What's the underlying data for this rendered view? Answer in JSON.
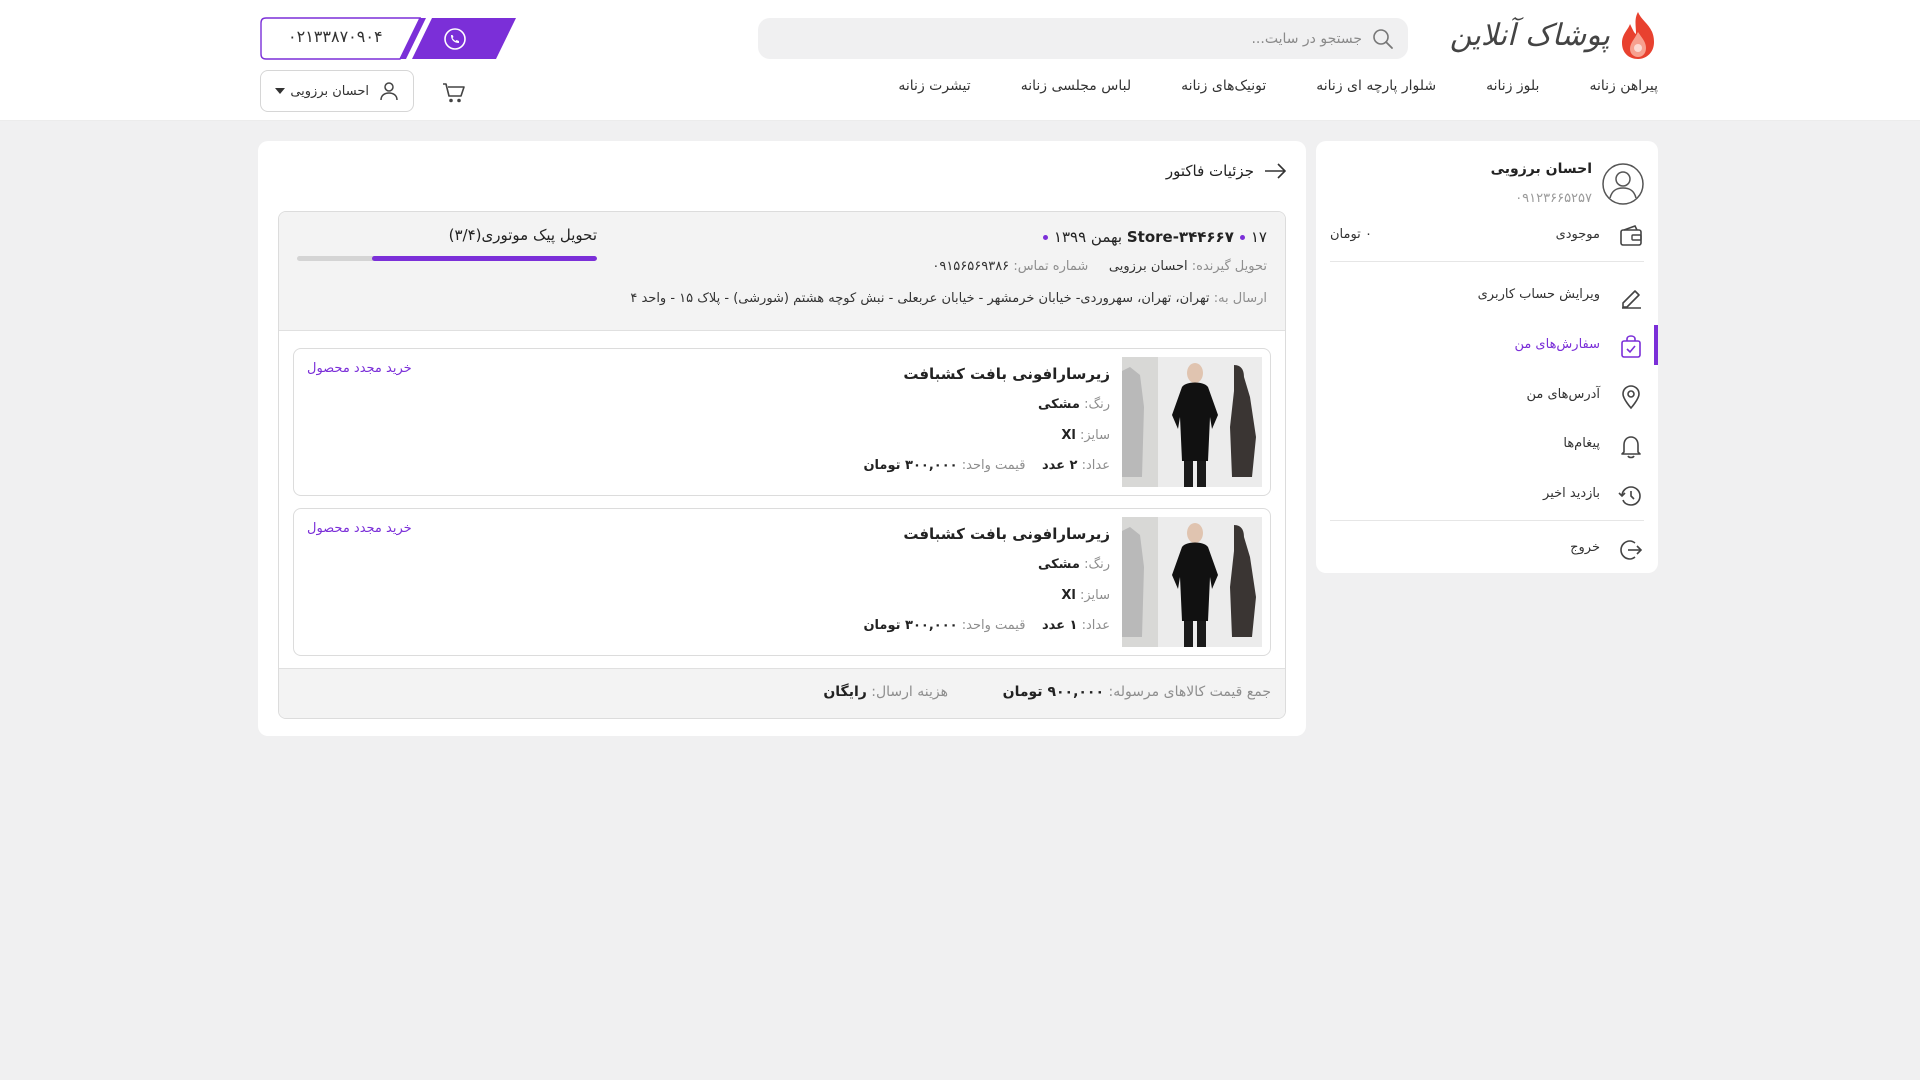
{
  "header": {
    "logo_text": "پوشاک آنلاین",
    "search_placeholder": "جستجو در سایت...",
    "phone_number": "۰۲۱۳۳۸۷۰۹۰۴",
    "user_name": "احسان برزویی",
    "nav": [
      "پیراهن زنانه",
      "بلوز زنانه",
      "شلوار پارچه ای زنانه",
      "تونیک‌های زنانه",
      "لباس مجلسی زنانه",
      "تیشرت زنانه"
    ],
    "accent_color": "#7b2fd8"
  },
  "sidebar": {
    "profile_name": "احسان برزویی",
    "profile_phone": "۰۹۱۲۳۶۶۵۲۵۷",
    "wallet_label": "موجودی",
    "wallet_value": "۰ تومان",
    "items": [
      {
        "label": "ویرایش حساب کاربری",
        "icon": "edit-icon"
      },
      {
        "label": "سفارش‌های من",
        "icon": "orders-bag-icon",
        "active": true
      },
      {
        "label": "آدرس‌های من",
        "icon": "location-pin-icon"
      },
      {
        "label": "پیغام‌ها",
        "icon": "bell-icon"
      },
      {
        "label": "بازدید اخیر",
        "icon": "history-icon"
      }
    ],
    "logout_label": "خروج"
  },
  "panel": {
    "title": "جزئیات فاکتور",
    "order": {
      "id": "Store-۳۴۴۶۶۷",
      "date": "۱۷ بهمن ۱۳۹۹",
      "recipient_label": "تحویل گیرنده:",
      "recipient": "احسان برزویی",
      "contact_label": "شماره تماس:",
      "contact": "۰۹۱۵۶۵۶۹۳۸۶",
      "address_label": "ارسال به:",
      "address": "تهران، تهران، سهروردی- خیابان خرمشهر - خیابان عربعلی - نبش کوچه هشتم (شورشی) - پلاک ۱۵ - واحد ۴",
      "delivery_label": "تحویل پیک موتوری(۳/۴)",
      "delivery_progress": 0.75
    },
    "items": [
      {
        "name": "زیرسارافونی بافت کشبافت",
        "color_label": "رنگ:",
        "color": "مشکی",
        "size_label": "سایز:",
        "size": "Xl",
        "qty_label": "عداد:",
        "qty": "۲ عدد",
        "price_label": "قیمت واحد:",
        "price": "۳۰۰,۰۰۰ تومان",
        "rebuy": "خرید مجدد محصول"
      },
      {
        "name": "زیرسارافونی بافت کشبافت",
        "color_label": "رنگ:",
        "color": "مشکی",
        "size_label": "سایز:",
        "size": "Xl",
        "qty_label": "عداد:",
        "qty": "۱ عدد",
        "price_label": "قیمت واحد:",
        "price": "۳۰۰,۰۰۰ تومان",
        "rebuy": "خرید مجدد محصول"
      }
    ],
    "footer": {
      "total_label": "جمع قیمت کالاهای مرسوله:",
      "total": "۹۰۰,۰۰۰ تومان",
      "shipping_label": "هزینه ارسال:",
      "shipping": "رایگان"
    }
  }
}
